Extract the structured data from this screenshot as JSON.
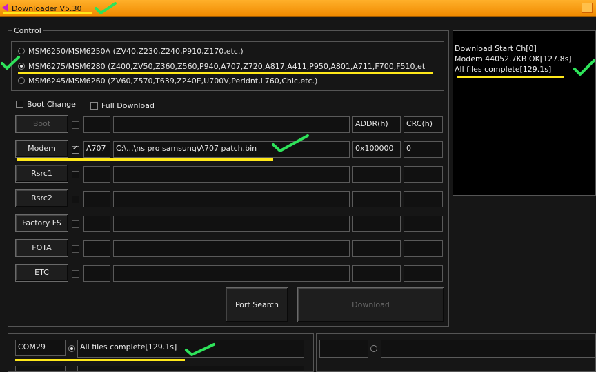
{
  "window": {
    "title": "Downloader V5.30"
  },
  "control": {
    "legend": "Control",
    "models": [
      {
        "label": "MSM6250/MSM6250A (ZV40,Z230,Z240,P910,Z170,etc.)",
        "selected": false
      },
      {
        "label": "MSM6275/MSM6280 (Z400,ZV50,Z360,Z560,P940,A707,Z720,A817,A411,P950,A801,A711,F700,F510,et",
        "selected": true
      },
      {
        "label": "MSM6245/MSM6260 (ZV60,Z570,T639,Z240E,U700V,Peridnt,L760,Chic,etc.)",
        "selected": false
      }
    ],
    "boot_change": {
      "label": "Boot Change",
      "checked": false
    },
    "full_download": {
      "label": "Full Download",
      "checked": false
    },
    "headers": {
      "addr": "ADDR(h)",
      "crc": "CRC(h)"
    },
    "rows": [
      {
        "label": "Boot",
        "checked": false,
        "enabled": false,
        "code": "",
        "path": "",
        "addr": "",
        "crc": ""
      },
      {
        "label": "Modem",
        "checked": true,
        "enabled": true,
        "code": "A707",
        "path": "C:\\...\\ns pro samsung\\A707  patch.bin",
        "addr": "0x100000",
        "crc": "0"
      },
      {
        "label": "Rsrc1",
        "checked": false,
        "enabled": true,
        "code": "",
        "path": "",
        "addr": "",
        "crc": ""
      },
      {
        "label": "Rsrc2",
        "checked": false,
        "enabled": true,
        "code": "",
        "path": "",
        "addr": "",
        "crc": ""
      },
      {
        "label": "Factory FS",
        "checked": false,
        "enabled": true,
        "code": "",
        "path": "",
        "addr": "",
        "crc": ""
      },
      {
        "label": "FOTA",
        "checked": false,
        "enabled": true,
        "code": "",
        "path": "",
        "addr": "",
        "crc": ""
      },
      {
        "label": "ETC",
        "checked": false,
        "enabled": true,
        "code": "",
        "path": "",
        "addr": "",
        "crc": ""
      }
    ],
    "port_search_label": "Port Search",
    "download_label": "Download"
  },
  "log": {
    "lines": [
      "Download Start Ch[0]",
      "Modem 44052.7KB OK[127.8s]",
      "All files complete[129.1s]"
    ]
  },
  "status": {
    "port": "COM29",
    "message": "All files complete[129.1s]",
    "port2": "",
    "message2": ""
  },
  "colors": {
    "titlebar": "#f5a000",
    "highlight": "#ffe81a",
    "checkmark": "#2ee35a",
    "background": "#161616"
  }
}
